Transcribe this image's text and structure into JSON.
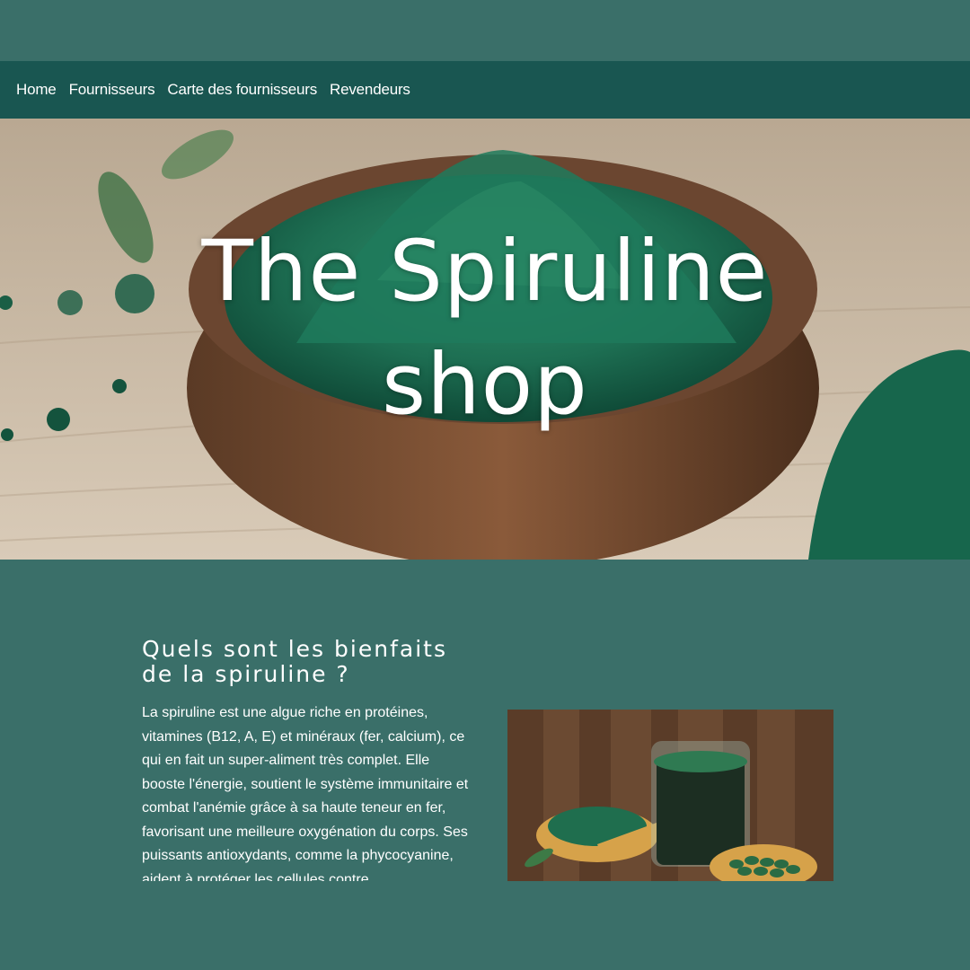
{
  "nav": {
    "items": [
      "Home",
      "Fournisseurs",
      "Carte des fournisseurs",
      "Revendeurs"
    ]
  },
  "hero": {
    "title_line1": "The Spiruline",
    "title_line2": "shop",
    "image": "bowl-of-green-spirulina-powder"
  },
  "content": {
    "heading": "Quels sont les bienfaits de la spiruline ?",
    "paragraph": "La spiruline est une algue riche en protéines, vitamines (B12, A, E) et minéraux (fer, calcium), ce qui en fait un super-aliment très complet. Elle booste l'énergie, soutient le système immunitaire et combat l'anémie grâce à sa haute teneur en fer, favorisant une meilleure oxygénation du corps. Ses puissants antioxydants, comme la phycocyanine, aident à protéger les cellules contre",
    "image": "spirulina-drink-and-tablets"
  },
  "colors": {
    "page_bg": "#3a6f69",
    "nav_bg": "#195651",
    "text": "#ffffff",
    "spirulina_green": "#1f7a5c"
  }
}
